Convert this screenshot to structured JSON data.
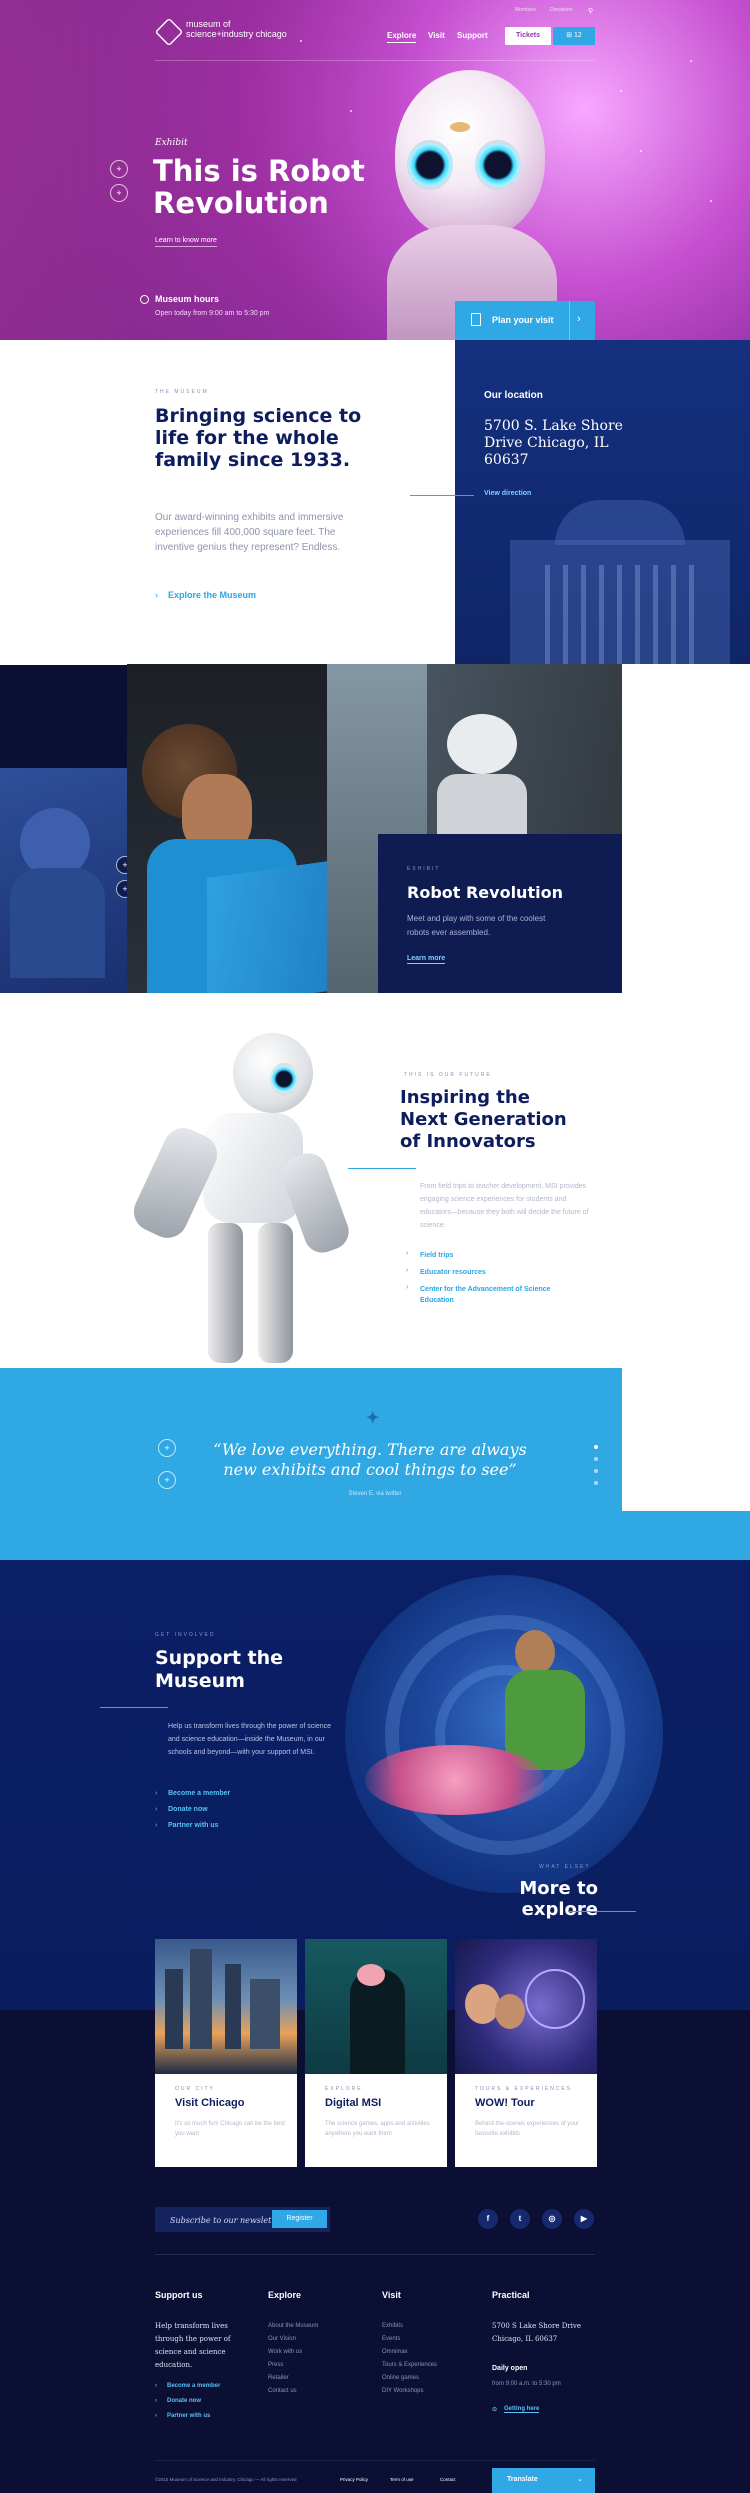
{
  "header": {
    "logo_text": "museum of science+industry chicago",
    "util_links": [
      "Members",
      "Donations"
    ],
    "nav": [
      "Explore",
      "Visit",
      "Support"
    ],
    "tickets_label": "Tickets",
    "cart_count": "12"
  },
  "hero": {
    "label": "Exhibit",
    "title": "This is Robot Revolution",
    "link": "Learn to know more",
    "hours_title": "Museum hours",
    "hours_text": "Open today from 9:00 am to 5:30 pm",
    "plan_label": "Plan your visit"
  },
  "museum": {
    "eyebrow": "THE MUSEUM",
    "title": "Bringing science to life for the whole family since 1933.",
    "body": "Our award-winning exhibits and immersive experiences fill 400,000 square feet. The inventive genius they represent? Endless.",
    "link": "Explore the Museum"
  },
  "location": {
    "title": "Our location",
    "address": "5700 S. Lake Shore Drive Chicago, IL 60637",
    "link": "View direction"
  },
  "robot_revolution": {
    "eyebrow": "EXHIBIT",
    "title": "Robot Revolution",
    "text": "Meet and play with some of the coolest robots ever assembled.",
    "link": "Learn more"
  },
  "innovators": {
    "eyebrow": "THIS IS OUR FUTURE",
    "title": "Inspiring the Next Generation of Innovators",
    "body": "From field trips to teacher development, MSI provides engaging science experiences for students and educators—because they both will decide the future of science.",
    "links": [
      "Field trips",
      "Educator resources",
      "Center for the Advancement of Science Education"
    ]
  },
  "quote": {
    "text": "“We love everything. There are always new exhibits and cool things to see”",
    "author": "Steven E. via twitter"
  },
  "support": {
    "eyebrow": "GET INVOLVED",
    "title": "Support the Museum",
    "text": "Help us transform lives through the power of science and science education—inside the Museum, in our schools and beyond—with your support of MSI.",
    "links": [
      "Become a member",
      "Donate now",
      "Partner with us"
    ]
  },
  "more": {
    "eyebrow": "WHAT ELSE?",
    "title": "More to explore",
    "cards": [
      {
        "eyebrow": "OUR CITY",
        "title": "Visit Chicago",
        "text": "It's so much fun! Chicago can be the best you want"
      },
      {
        "eyebrow": "EXPLORE",
        "title": "Digital MSI",
        "text": "The science games, apps and activities anywhere you want them"
      },
      {
        "eyebrow": "TOURS & EXPERIENCES",
        "title": "WOW! Tour",
        "text": "Behind-the-scenes experiences of your favourite exhibits"
      }
    ]
  },
  "newsletter": {
    "placeholder": "Subscribe to our newsletter",
    "button": "Register"
  },
  "social": [
    "f",
    "t",
    "ig",
    "yt"
  ],
  "footer": {
    "support_title": "Support us",
    "support_text": "Help transform lives through the power of science and science education.",
    "support_links": [
      "Become a member",
      "Donate now",
      "Partner with us"
    ],
    "explore_title": "Explore",
    "explore_links": [
      "About the Museum",
      "Our Vision",
      "Work with us",
      "Press",
      "Retailer",
      "Contact us"
    ],
    "visit_title": "Visit",
    "visit_links": [
      "Exhibits",
      "Events",
      "Omnimax",
      "Tours & Experiences",
      "Online games",
      "DIY Workshops"
    ],
    "practical_title": "Practical",
    "practical_address": "5700 S Lake Shore Drive Chicago, IL 60637",
    "daily_title": "Daily open",
    "daily_text": "from 9:00 a.m. to 5:30 pm",
    "getting_here": "Getting here",
    "copyright": "©2015 Museum of Science and Industry, Chicago — All rights reserved",
    "bottom_links": [
      "Privacy Policy",
      "Term of use",
      "Contact"
    ],
    "translate": "Translate"
  }
}
